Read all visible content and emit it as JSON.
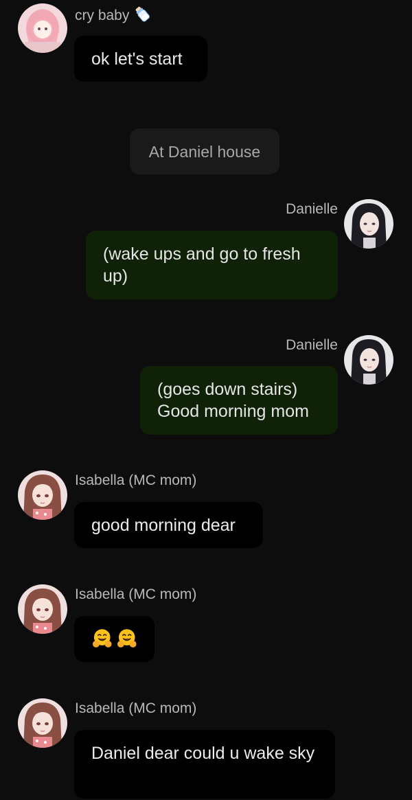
{
  "messages": [
    {
      "sender": "cry baby",
      "text": "ok let's start"
    },
    {
      "narration": "At Daniel house"
    },
    {
      "sender": "Danielle",
      "text": "(wake ups and go to fresh up)"
    },
    {
      "sender": "Danielle",
      "line1": "(goes down stairs)",
      "line2": "Good morning mom"
    },
    {
      "sender": "Isabella (MC mom)",
      "text": "good morning dear"
    },
    {
      "sender": "Isabella (MC mom)",
      "emoji": [
        "hugging-face",
        "hugging-face"
      ]
    },
    {
      "sender": "Isabella (MC mom)",
      "text": "Daniel dear could u wake sky"
    }
  ],
  "colors": {
    "background": "#0d0d0d",
    "incoming_bubble": "#000000",
    "outgoing_bubble": "#0f2106",
    "narration_bubble": "#1a1a1a",
    "sender_name": "#b9b9b9"
  }
}
